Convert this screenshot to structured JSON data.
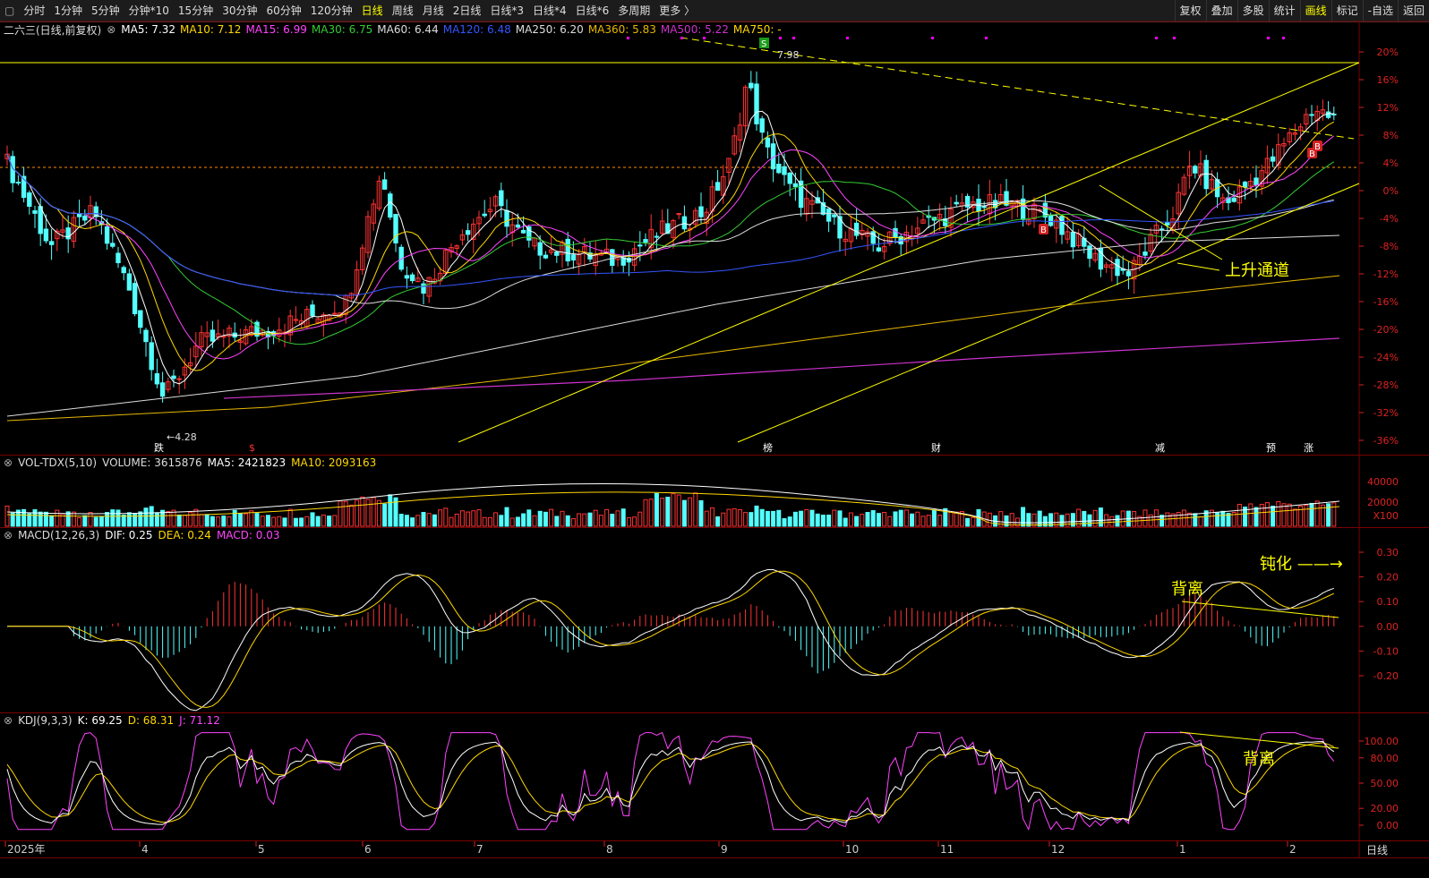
{
  "toolbar": {
    "left_items": [
      "分时",
      "1分钟",
      "5分钟",
      "分钟*10",
      "15分钟",
      "30分钟",
      "60分钟",
      "120分钟",
      "日线",
      "周线",
      "月线",
      "2日线",
      "日线*3",
      "日线*4",
      "日线*6",
      "多周期",
      "更多 〉"
    ],
    "active": "日线",
    "right_items": [
      "复权",
      "叠加",
      "多股",
      "统计",
      "画线",
      "标记",
      "-自选",
      "返回"
    ],
    "right_active": "画线"
  },
  "main_header": {
    "name": "二六三(日线,前复权)",
    "ma": [
      {
        "label": "MA5: 7.32",
        "color": "#ffffff"
      },
      {
        "label": "MA10: 7.12",
        "color": "#ffd700"
      },
      {
        "label": "MA15: 6.99",
        "color": "#ff44ff"
      },
      {
        "label": "MA30: 6.75",
        "color": "#33cc33"
      },
      {
        "label": "MA60: 6.44",
        "color": "#dddddd"
      },
      {
        "label": "MA120: 6.48",
        "color": "#3355ff"
      },
      {
        "label": "MA250: 6.20",
        "color": "#dddddd"
      },
      {
        "label": "MA360: 5.83",
        "color": "#e6b800"
      },
      {
        "label": "MA500: 5.22",
        "color": "#cc33cc"
      },
      {
        "label": "MA750: -",
        "color": "#ffd700"
      }
    ]
  },
  "vol_header": {
    "title": "VOL-TDX(5,10)",
    "volume": "VOLUME: 3615876",
    "ma5": "MA5: 2421823",
    "ma10": "MA10: 2093163"
  },
  "macd_header": {
    "title": "MACD(12,26,3)",
    "dif": "DIF: 0.25",
    "dea": "DEA: 0.24",
    "macd": "MACD: 0.03"
  },
  "kdj_header": {
    "title": "KDJ(9,3,3)",
    "k": "K: 69.25",
    "d": "D: 68.31",
    "j": "J: 71.12"
  },
  "price_axis": [
    "20%",
    "16%",
    "12%",
    "8%",
    "4%",
    "0%",
    "-4%",
    "-8%",
    "-12%",
    "-16%",
    "-20%",
    "-24%",
    "-28%",
    "-32%",
    "-36%"
  ],
  "vol_axis": [
    "40000",
    "20000",
    "X100"
  ],
  "macd_axis": [
    "0.30",
    "0.20",
    "0.10",
    "0.00",
    "-0.10",
    "-0.20"
  ],
  "kdj_axis": [
    "100.00",
    "80.00",
    "50.00",
    "20.00",
    "0.00"
  ],
  "x_axis": [
    "2025年",
    "4",
    "5",
    "6",
    "7",
    "8",
    "9",
    "10",
    "11",
    "12",
    "1",
    "2"
  ],
  "annotations": {
    "high": "7.98",
    "low": "←4.28",
    "channel": "上升通道",
    "macd_div": "背离",
    "macd_blunt": "钝化 ——→",
    "kdj_div": "背离",
    "s_marker": "S",
    "b_marker": "B"
  },
  "event_tags": [
    "跌",
    "$",
    "榜",
    "财",
    "减",
    "预",
    "涨"
  ],
  "period_label": "日线",
  "colors": {
    "up": "#ff3333",
    "down": "#54ffff",
    "grid": "#7a0000",
    "axis": "#d22222",
    "line": "#ffff00"
  },
  "chart_data": [
    {
      "type": "line",
      "title": "二六三(日线,前复权)",
      "y_axis": "percent change",
      "ylim": [
        -36,
        20
      ],
      "high": 7.98,
      "low": 4.28,
      "series": [
        {
          "name": "MA5",
          "value": 7.32
        },
        {
          "name": "MA10",
          "value": 7.12
        },
        {
          "name": "MA15",
          "value": 6.99
        },
        {
          "name": "MA30",
          "value": 6.75
        },
        {
          "name": "MA60",
          "value": 6.44
        },
        {
          "name": "MA120",
          "value": 6.48
        },
        {
          "name": "MA250",
          "value": 6.2
        },
        {
          "name": "MA360",
          "value": 5.83
        },
        {
          "name": "MA500",
          "value": 5.22
        }
      ]
    },
    {
      "type": "bar",
      "title": "VOL-TDX(5,10)",
      "volume": 3615876,
      "ma5": 2421823,
      "ma10": 2093163,
      "ylim": [
        0,
        40000
      ]
    },
    {
      "type": "line",
      "title": "MACD(12,26,3)",
      "series": [
        {
          "name": "DIF",
          "value": 0.25
        },
        {
          "name": "DEA",
          "value": 0.24
        },
        {
          "name": "MACD",
          "value": 0.03
        }
      ],
      "ylim": [
        -0.2,
        0.3
      ]
    },
    {
      "type": "line",
      "title": "KDJ(9,3,3)",
      "series": [
        {
          "name": "K",
          "value": 69.25
        },
        {
          "name": "D",
          "value": 68.31
        },
        {
          "name": "J",
          "value": 71.12
        }
      ],
      "ylim": [
        0,
        100
      ]
    }
  ]
}
